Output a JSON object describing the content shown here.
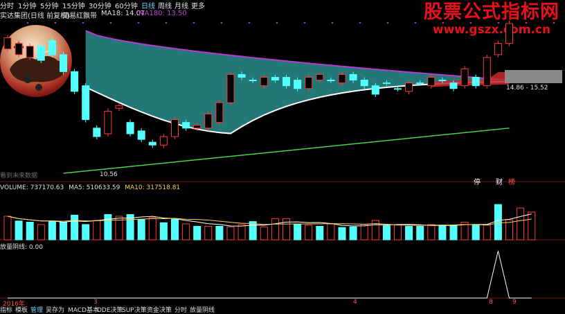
{
  "toolbar": {
    "items": [
      "分时",
      "1分钟",
      "5分钟",
      "15分钟",
      "30分钟",
      "60分钟",
      "日线",
      "周线",
      "月线",
      "更多"
    ],
    "active_index": 6
  },
  "info": {
    "stock": "实达集团(日线 前复权)",
    "indicator": "简易红飘带",
    "ma18_label": "MA18: 14.07",
    "ma180_label": "MA180: 13.50"
  },
  "watermark": {
    "line1": "股票公式指标网",
    "line2": "www.gszx.com.cn"
  },
  "colors": {
    "candle_up": "#ff3a3a",
    "candle_down": "#54ffff",
    "ma180": "#b43cd2",
    "ma18": "#ffffff",
    "teal_band": "#2a8c8c",
    "red_band": "#c8282d",
    "trend": "#46d746",
    "vol_ma5": "#ffffff",
    "vol_ma10": "#ffd25a",
    "watermark": "#e8101a",
    "active_tab": "#6fd3ff"
  },
  "chart_data": [
    {
      "type": "candlestick",
      "title": "简易红飘带",
      "candles": [
        {
          "o": 14.6,
          "c": 15.0
        },
        {
          "o": 14.4,
          "c": 14.8
        },
        {
          "o": 14.3,
          "c": 14.7
        },
        {
          "o": 14.7,
          "c": 14.2
        },
        {
          "o": 14.9,
          "c": 14.4
        },
        {
          "o": 14.4,
          "c": 13.8
        },
        {
          "o": 13.8,
          "c": 13.1
        },
        {
          "o": 13.3,
          "c": 12.1
        },
        {
          "o": 11.8,
          "c": 11.5
        },
        {
          "o": 11.6,
          "c": 12.4
        },
        {
          "o": 12.5,
          "c": 12.6
        },
        {
          "o": 12.0,
          "c": 11.6
        },
        {
          "o": 11.7,
          "c": 11.4
        },
        {
          "o": 11.3,
          "c": 11.2
        },
        {
          "o": 11.2,
          "c": 11.5
        },
        {
          "o": 11.5,
          "c": 12.1
        },
        {
          "o": 12.0,
          "c": 11.8
        },
        {
          "o": 11.8,
          "c": 11.9
        },
        {
          "o": 11.8,
          "c": 12.3
        },
        {
          "o": 12.0,
          "c": 12.7
        },
        {
          "o": 12.7,
          "c": 13.7
        },
        {
          "o": 13.7,
          "c": 13.6
        },
        {
          "o": 13.5,
          "c": 13.5
        },
        {
          "o": 13.3,
          "c": 13.6
        },
        {
          "o": 13.6,
          "c": 13.5
        },
        {
          "o": 13.6,
          "c": 13.3
        },
        {
          "o": 13.5,
          "c": 13.2
        },
        {
          "o": 13.2,
          "c": 13.6
        },
        {
          "o": 13.5,
          "c": 13.7
        },
        {
          "o": 13.5,
          "c": 13.5
        },
        {
          "o": 13.4,
          "c": 13.7
        },
        {
          "o": 13.7,
          "c": 13.5
        },
        {
          "o": 13.5,
          "c": 13.3
        },
        {
          "o": 13.3,
          "c": 13.0
        },
        {
          "o": 13.4,
          "c": 13.4
        },
        {
          "o": 13.2,
          "c": 13.2
        },
        {
          "o": 13.1,
          "c": 13.4
        },
        {
          "o": 13.4,
          "c": 13.4
        },
        {
          "o": 13.3,
          "c": 13.6
        },
        {
          "o": 13.5,
          "c": 13.5
        },
        {
          "o": 13.4,
          "c": 13.2
        },
        {
          "o": 13.3,
          "c": 13.9
        },
        {
          "o": 13.6,
          "c": 13.3
        },
        {
          "o": 13.3,
          "c": 14.3
        },
        {
          "o": 14.4,
          "c": 14.8
        },
        {
          "o": 14.8,
          "c": 15.5
        }
      ],
      "price_range": [
        10.2,
        15.6
      ],
      "low_label": "10.56",
      "price_range_label": "14.86 - 15.52",
      "side_labels": [
        "停",
        "财",
        "榜"
      ],
      "future_label": "看到未来数据"
    },
    {
      "type": "bar",
      "title": "VOLUME",
      "labels": {
        "volume": "VOLUME: 737170.63",
        "ma5": "MA5: 510633.59",
        "ma10": "MA10: 317518.81"
      },
      "values": [
        400,
        320,
        300,
        260,
        320,
        300,
        420,
        260,
        330,
        430,
        400,
        430,
        350,
        380,
        290,
        350,
        270,
        230,
        230,
        230,
        220,
        260,
        310,
        220,
        360,
        360,
        270,
        250,
        230,
        270,
        210,
        220,
        260,
        330,
        240,
        250,
        230,
        230,
        260,
        250,
        250,
        300,
        250,
        250,
        600,
        340,
        540,
        470
      ],
      "up_flags": [
        1,
        0,
        0,
        1,
        0,
        0,
        0,
        0,
        1,
        0,
        1,
        0,
        0,
        1,
        0,
        0,
        1,
        0,
        1,
        0,
        1,
        1,
        0,
        1,
        1,
        1,
        0,
        1,
        0,
        1,
        0,
        0,
        1,
        1,
        0,
        1,
        0,
        0,
        1,
        0,
        0,
        1,
        0,
        1,
        0,
        1,
        1,
        1
      ],
      "ylim": [
        0,
        800
      ]
    },
    {
      "type": "line",
      "title": "放量阴线",
      "label": "放量阴线: 0.00",
      "values": [
        0,
        0,
        0,
        0,
        0,
        0,
        0,
        0,
        0,
        0,
        0,
        0,
        0,
        0,
        0,
        0,
        0,
        0,
        0,
        0,
        0,
        0,
        0,
        0,
        0,
        0,
        0,
        0,
        0,
        0,
        0,
        0,
        0,
        0,
        0,
        0,
        0,
        0,
        0,
        0,
        0,
        0,
        0,
        0,
        1,
        0,
        0,
        0
      ],
      "ylim": [
        0,
        1
      ]
    }
  ],
  "time_axis": {
    "year": "2016年",
    "marks": [
      "3",
      "4",
      "8",
      "9"
    ]
  },
  "tabs": {
    "items": [
      "指标",
      "模板",
      "管理",
      "吴存为",
      "MACD基本",
      "DDE决策",
      "SUP决策",
      "资金决策",
      "分时",
      "放量阴线"
    ],
    "active_index": 2
  }
}
